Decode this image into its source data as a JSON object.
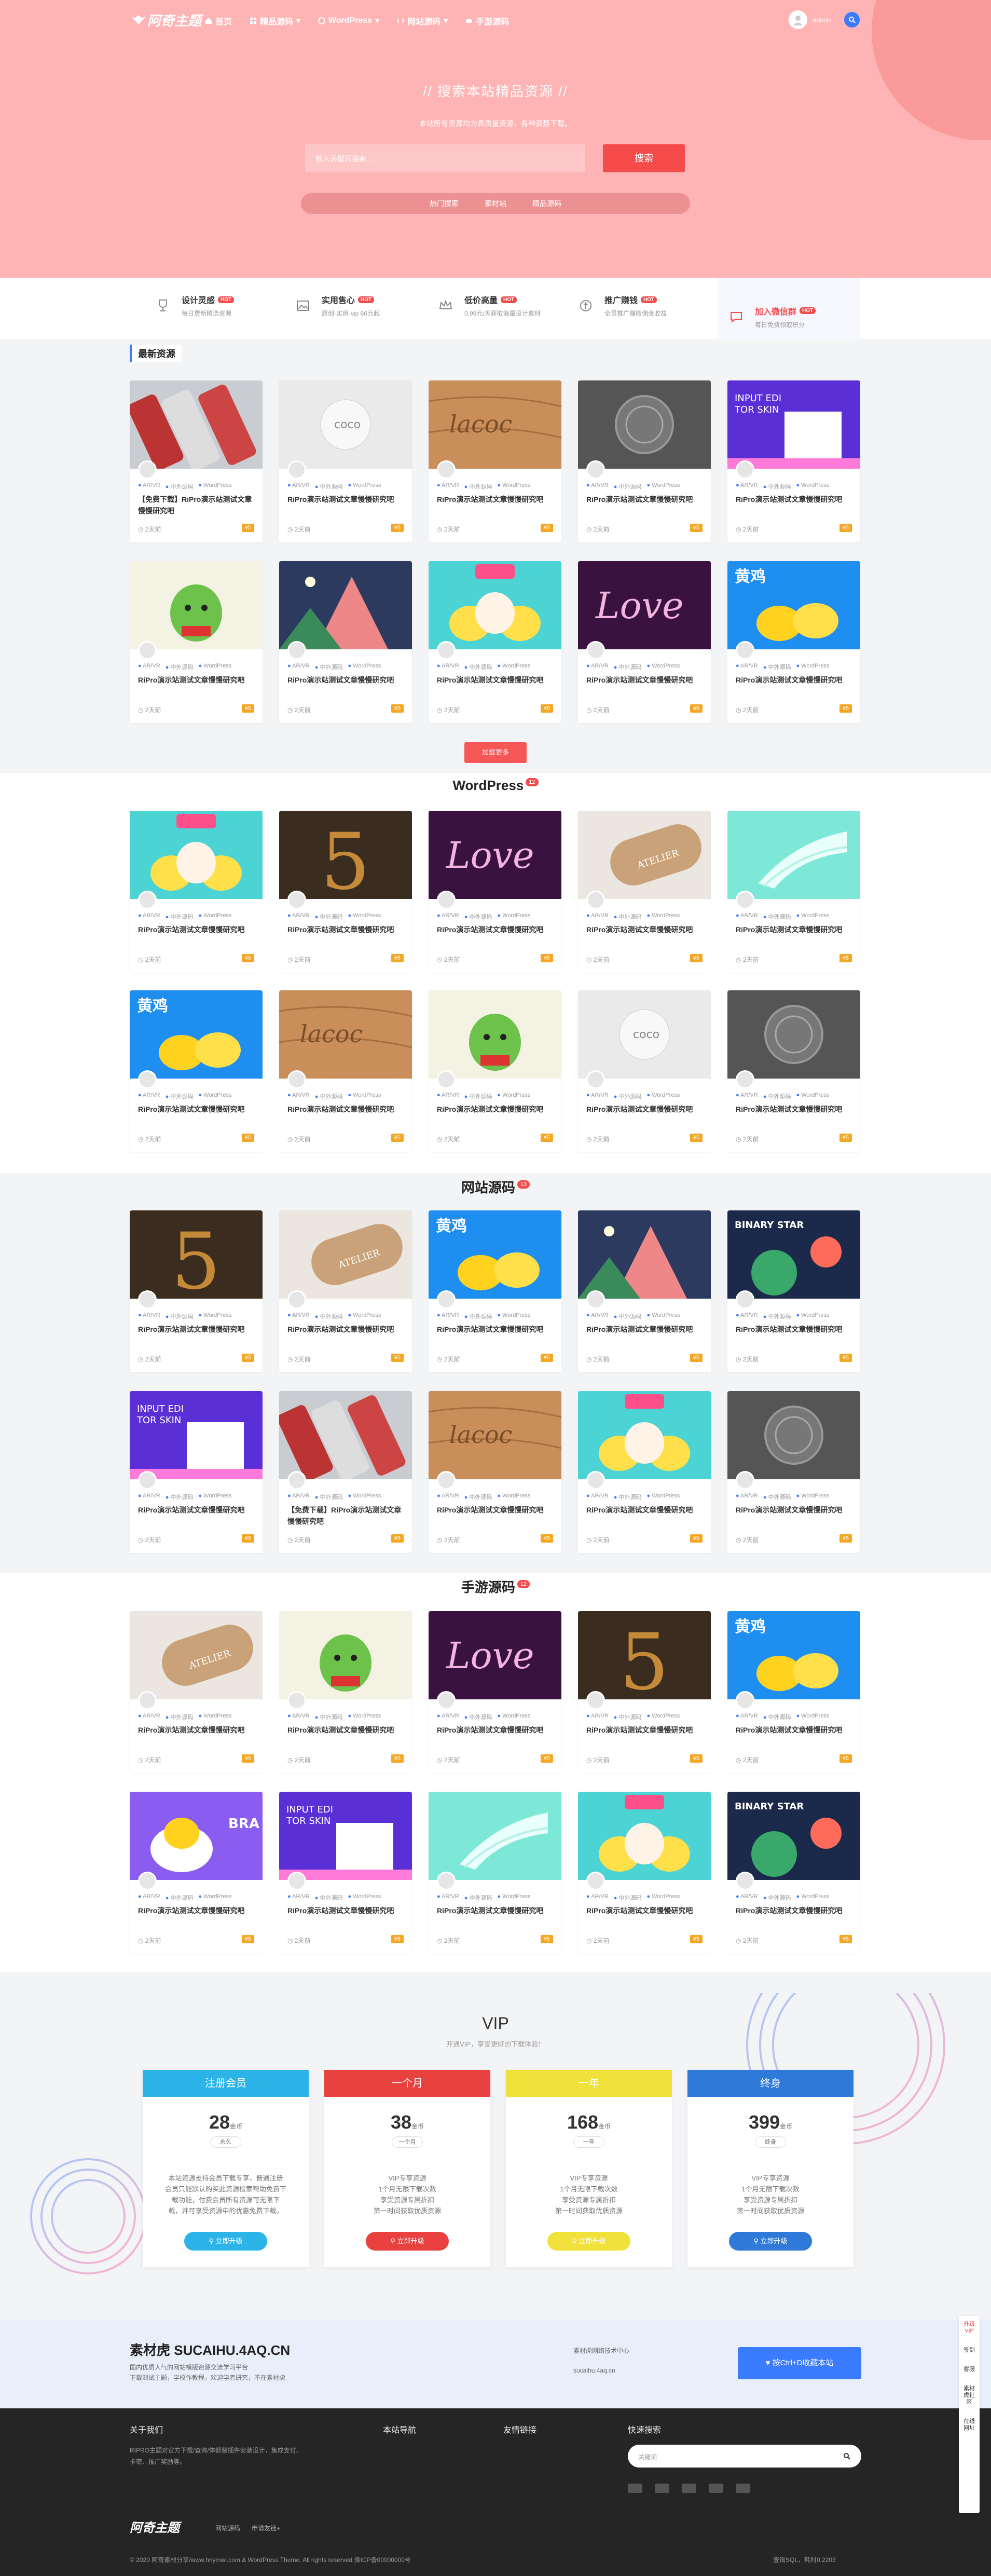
{
  "header": {
    "logo": "阿奇主题",
    "nav": [
      "首页",
      "精品源码",
      "WordPress",
      "网站源码",
      "手游源码"
    ],
    "user": "admin"
  },
  "hero": {
    "title": "// 搜索本站精品资源 //",
    "subtitle": "本站所有资源均为高质量资源，各种姿势下载。",
    "placeholder": "输入关键词搜索...",
    "button": "搜索",
    "tags": [
      "热门搜索",
      "素材站",
      "精品源码"
    ]
  },
  "features": [
    {
      "title": "设计灵感",
      "badge": "HOT",
      "desc": "每日更新精选资源"
    },
    {
      "title": "实用售心",
      "badge": "HOT",
      "desc": "原创·实用·vip 66元起"
    },
    {
      "title": "低价高量",
      "badge": "HOT",
      "desc": "0.99元/天获取海量设计素材"
    },
    {
      "title": "推广赚钱",
      "badge": "HOT",
      "desc": "全员推广赚取佣金收益"
    },
    {
      "title": "加入微信群",
      "badge": "HOT",
      "desc": "每日免费领取积分"
    }
  ],
  "latest_label": "最新资源",
  "more_button": "加载更多",
  "card_meta": {
    "cat1": "AR/VR",
    "cat2": "中外源码",
    "cat3": "WordPress",
    "date": "2天前",
    "price": "¥5"
  },
  "card_title": "RiPro演示站测试文章慢慢研究吧",
  "card_title_hot": "【免费下载】RiPro演示站测试文章慢慢研究吧",
  "sections": [
    {
      "title": "WordPress",
      "badge": "12"
    },
    {
      "title": "网站源码",
      "badge": "13"
    },
    {
      "title": "手游源码",
      "badge": "12"
    }
  ],
  "vip": {
    "title": "VIP",
    "subtitle": "开通VIP，享受更好的下载体验！",
    "plans": [
      {
        "name": "注册会员",
        "price": "28",
        "unit": "金币",
        "term": "永久",
        "desc": "本站资源支持会员下载专享，普通注册\n会员只能默认购买此资源检索帮助免费下\n载功能，付费会员所有资源可无限下\n载，并可享受资源中的优惠免费下载。",
        "btn": "立即升级",
        "color": "#2cb4e8"
      },
      {
        "name": "一个月",
        "price": "38",
        "unit": "金币",
        "term": "一个月",
        "desc": "VIP专享资源\n1个月无限下载次数\n享受资源专属折扣\n第一时间获取优质资源",
        "btn": "立即升级",
        "color": "#e94040"
      },
      {
        "name": "一年",
        "price": "168",
        "unit": "金币",
        "term": "一年",
        "desc": "VIP专享资源\n1个月无限下载次数\n享受资源专属折扣\n第一时间获取优质资源",
        "btn": "立即升级",
        "color": "#f0e23a"
      },
      {
        "name": "终身",
        "price": "399",
        "unit": "金币",
        "term": "终身",
        "desc": "VIP专享资源\n1个月无限下载次数\n享受资源专属折扣\n第一时间获取优质资源",
        "btn": "立即升级",
        "color": "#2f79d8"
      }
    ]
  },
  "promo": {
    "title": "素材虎 SUCAIHU.4AQ.CN",
    "line1": "国内优质人气的网站模版资源交流学习平台",
    "line2": "下载测试主题，学校作教程，欢迎学者研究，不在素材虎",
    "mid1": "素材虎网络技术中心",
    "mid2": "sucaihu.4aq.cn",
    "button": "按Ctrl+D收藏本站"
  },
  "footer": {
    "about_title": "关于我们",
    "about_text": "RIPRO主题对官方下载/查询/体都替插件安装设计，集成支付、卡密、推广奖励等。",
    "nav_title": "本站导航",
    "links_title": "友情链接",
    "search_title": "快速搜索",
    "search_placeholder": "关键词",
    "logo": "阿奇主题",
    "flinks": [
      "网站源码",
      "申请友链+"
    ],
    "copyright": "© 2020 阿奇素材分享/www.hnymwl.com & WordPress Theme. All rights reserved 豫ICP备00000000号",
    "copyright_right": "查询SQL，耗时0.2203"
  },
  "side": [
    "升级VIP",
    "签到",
    "客服",
    "素材虎社区",
    "在线网址"
  ]
}
